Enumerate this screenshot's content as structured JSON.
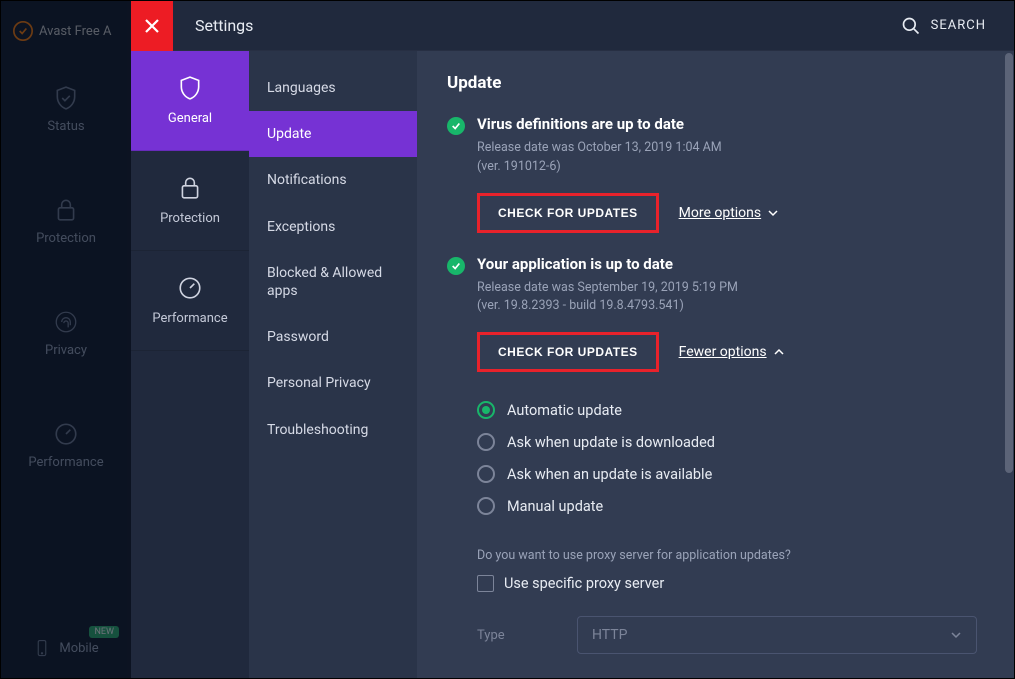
{
  "app": {
    "name_fragment": "Avast Free A",
    "topbar_title": "Settings",
    "search_label": "SEARCH"
  },
  "far_nav": {
    "items": [
      {
        "label": "Status"
      },
      {
        "label": "Protection"
      },
      {
        "label": "Privacy"
      },
      {
        "label": "Performance"
      },
      {
        "label": "Mobile",
        "new_badge": "NEW"
      }
    ]
  },
  "categories": {
    "items": [
      {
        "label": "General"
      },
      {
        "label": "Protection"
      },
      {
        "label": "Performance"
      }
    ]
  },
  "sub_sidebar": {
    "items": [
      {
        "label": "Languages"
      },
      {
        "label": "Update"
      },
      {
        "label": "Notifications"
      },
      {
        "label": "Exceptions"
      },
      {
        "label": "Blocked & Allowed apps"
      },
      {
        "label": "Password"
      },
      {
        "label": "Personal Privacy"
      },
      {
        "label": "Troubleshooting"
      }
    ]
  },
  "panel": {
    "title": "Update",
    "virus": {
      "title": "Virus definitions are up to date",
      "release_line": "Release date was October 13, 2019 1:04 AM",
      "version_line": "(ver. 191012-6)",
      "check_btn": "CHECK FOR UPDATES",
      "options_link": "More options"
    },
    "appupd": {
      "title": "Your application is up to date",
      "release_line": "Release date was September 19, 2019 5:19 PM",
      "version_line": "(ver. 19.8.2393 - build 19.8.4793.541)",
      "check_btn": "CHECK FOR UPDATES",
      "options_link": "Fewer options",
      "radios": [
        "Automatic update",
        "Ask when update is downloaded",
        "Ask when an update is available",
        "Manual update"
      ],
      "proxy_question": "Do you want to use proxy server for application updates?",
      "proxy_check_label": "Use specific proxy server",
      "type_label": "Type",
      "type_value": "HTTP"
    }
  }
}
